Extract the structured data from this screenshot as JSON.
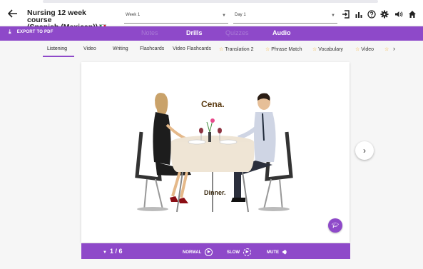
{
  "header": {
    "title_line1": "Nursing 12 week course",
    "title_line2": "(Spanish (Mexican))",
    "week_select": "Week 1",
    "day_select": "Day 1"
  },
  "purplebar": {
    "export_label": "EXPORT TO PDF",
    "tabs": [
      {
        "label": "Notes",
        "active": false
      },
      {
        "label": "Drills",
        "active": true
      },
      {
        "label": "Quizzes",
        "active": false
      },
      {
        "label": "Audio",
        "active": true
      }
    ]
  },
  "subtabs": [
    {
      "label": "Listening",
      "star": false
    },
    {
      "label": "Video",
      "star": false
    },
    {
      "label": "Writing",
      "star": false
    },
    {
      "label": "Flashcards",
      "star": false
    },
    {
      "label": "Video Flashcards",
      "star": false
    },
    {
      "label": "Translation 2",
      "star": true
    },
    {
      "label": "Phrase Match",
      "star": true
    },
    {
      "label": "Vocabulary",
      "star": true
    },
    {
      "label": "Video",
      "star": true
    }
  ],
  "card": {
    "phrase": "Cena.",
    "translation": "Dinner."
  },
  "player": {
    "pager": "1 / 6",
    "normal_label": "NORMAL",
    "slow_label": "SLOW",
    "mute_label": "MUTE"
  },
  "colors": {
    "accent": "#8e49c9",
    "star": "#f3a81b"
  }
}
